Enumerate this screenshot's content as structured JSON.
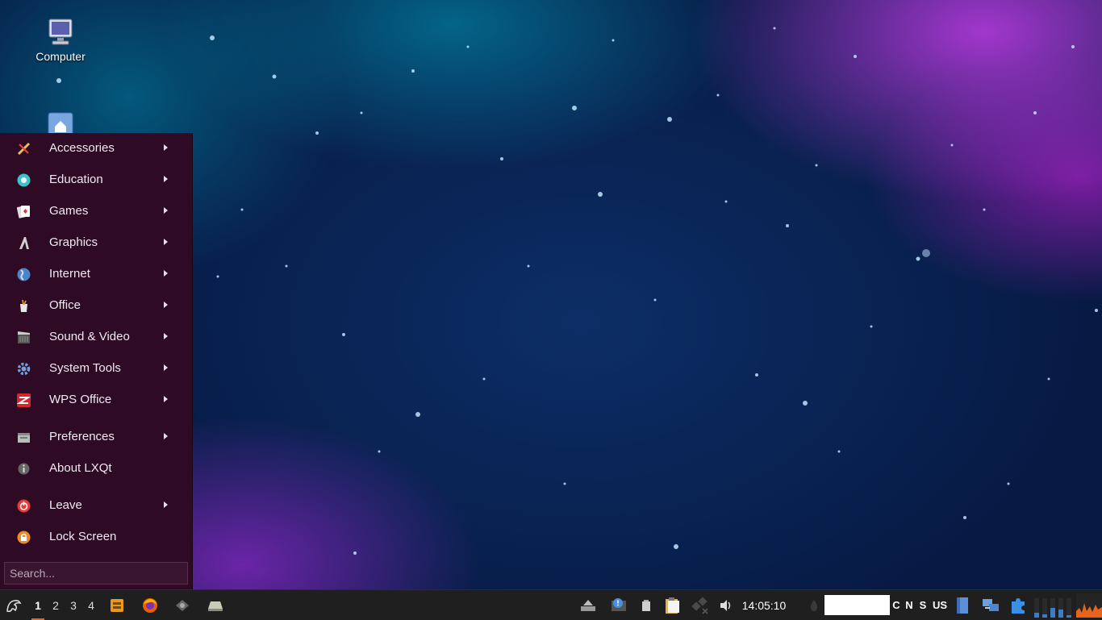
{
  "desktop": {
    "icons": [
      {
        "label": "Computer",
        "icon": "computer-icon"
      },
      {
        "label": "",
        "icon": "home-folder-icon"
      }
    ]
  },
  "menu": {
    "items": [
      {
        "label": "Accessories",
        "icon": "accessories-icon",
        "submenu": true
      },
      {
        "label": "Education",
        "icon": "education-icon",
        "submenu": true
      },
      {
        "label": "Games",
        "icon": "games-icon",
        "submenu": true
      },
      {
        "label": "Graphics",
        "icon": "graphics-icon",
        "submenu": true
      },
      {
        "label": "Internet",
        "icon": "internet-icon",
        "submenu": true
      },
      {
        "label": "Office",
        "icon": "office-icon",
        "submenu": true
      },
      {
        "label": "Sound & Video",
        "icon": "sound-video-icon",
        "submenu": true
      },
      {
        "label": "System Tools",
        "icon": "system-tools-icon",
        "submenu": true
      },
      {
        "label": "WPS Office",
        "icon": "wps-office-icon",
        "submenu": true
      },
      {
        "label": "Preferences",
        "icon": "preferences-icon",
        "submenu": true
      },
      {
        "label": "About LXQt",
        "icon": "info-icon",
        "submenu": false
      },
      {
        "label": "Leave",
        "icon": "power-icon",
        "submenu": true
      },
      {
        "label": "Lock Screen",
        "icon": "lock-icon",
        "submenu": false
      }
    ],
    "search": {
      "placeholder": "Search..."
    }
  },
  "taskbar": {
    "workspaces": [
      "1",
      "2",
      "3",
      "4"
    ],
    "active_workspace": "1",
    "launchers": [
      "file-manager-icon",
      "firefox-icon",
      "network-tool-icon",
      "drive-icon"
    ],
    "clock": "14:05:10",
    "keyboard_indicators": [
      "C",
      "N",
      "S"
    ],
    "keyboard_layout": "US",
    "colors": {
      "accent": "#e8631c",
      "menu_bg": "#2e0a24",
      "panel_bg": "#1f1f1f"
    }
  }
}
